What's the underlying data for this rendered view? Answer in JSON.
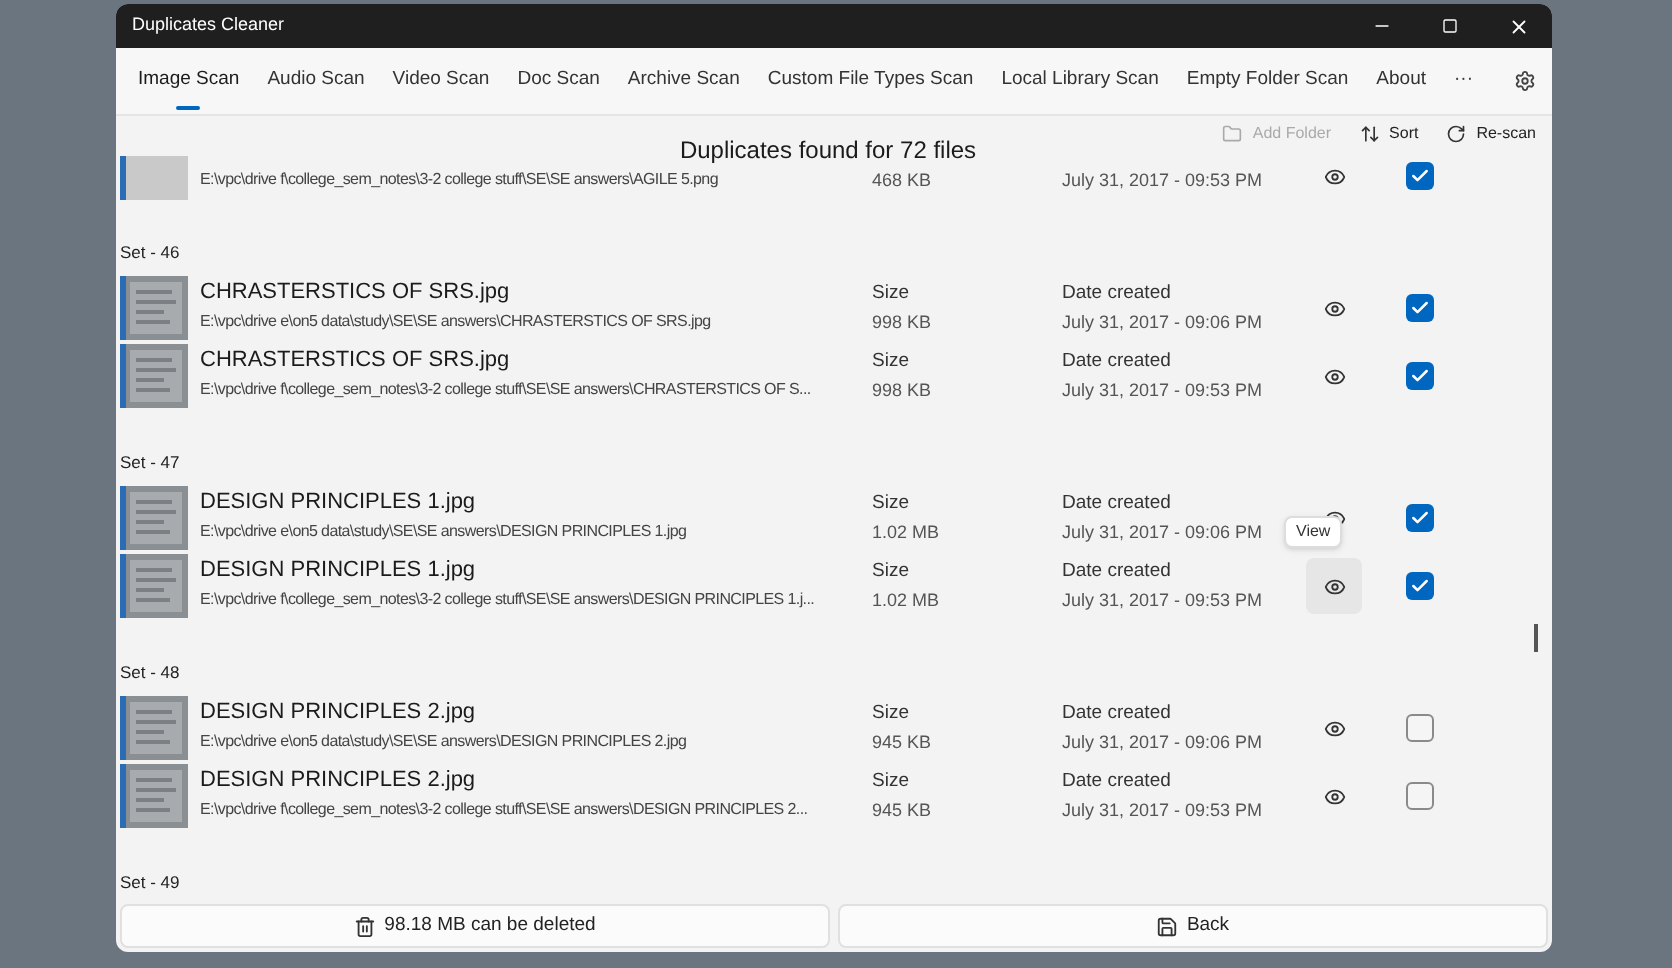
{
  "window": {
    "title": "Duplicates Cleaner"
  },
  "tabs": [
    {
      "label": "Image Scan",
      "selected": true
    },
    {
      "label": "Audio Scan",
      "selected": false
    },
    {
      "label": "Video Scan",
      "selected": false
    },
    {
      "label": "Doc Scan",
      "selected": false
    },
    {
      "label": "Archive Scan",
      "selected": false
    },
    {
      "label": "Custom File Types Scan",
      "selected": false
    },
    {
      "label": "Local Library Scan",
      "selected": false
    },
    {
      "label": "Empty Folder Scan",
      "selected": false
    },
    {
      "label": "About",
      "selected": false
    },
    {
      "label": "···",
      "selected": false
    }
  ],
  "heading": "Duplicates found for 72 files",
  "toolbar": [
    {
      "label": "Add Folder",
      "kind": "folder",
      "disabled": true
    },
    {
      "label": "Sort",
      "kind": "sort",
      "disabled": false
    },
    {
      "label": "Re-scan",
      "kind": "rescan",
      "disabled": false
    }
  ],
  "sets": [
    {
      "rows": [
        {
          "path": "E:\\vpc\\drive f\\college_sem_notes\\3-2 college stuff\\SE\\SE answers\\AGILE 5.png",
          "size": "468 KB",
          "date": "July 31, 2017 - 09:53 PM",
          "checked": true
        }
      ]
    },
    {
      "label": "Set - 46",
      "rows": [
        {
          "name": "CHRASTERSTICS OF SRS.jpg",
          "path": "E:\\vpc\\drive e\\on5 data\\study\\SE\\SE answers\\CHRASTERSTICS OF SRS.jpg",
          "size_label": "Size",
          "size": "998 KB",
          "date_label": "Date created",
          "date": "July 31, 2017 - 09:06 PM",
          "checked": true
        },
        {
          "name": "CHRASTERSTICS OF SRS.jpg",
          "path": "E:\\vpc\\drive f\\college_sem_notes\\3-2 college stuff\\SE\\SE answers\\CHRASTERSTICS OF S...",
          "size_label": "Size",
          "size": "998 KB",
          "date_label": "Date created",
          "date": "July 31, 2017 - 09:53 PM",
          "checked": true
        }
      ]
    },
    {
      "label": "Set - 47",
      "rows": [
        {
          "name": "DESIGN PRINCIPLES 1.jpg",
          "path": "E:\\vpc\\drive e\\on5 data\\study\\SE\\SE answers\\DESIGN PRINCIPLES 1.jpg",
          "size_label": "Size",
          "size": "1.02 MB",
          "date_label": "Date created",
          "date": "July 31, 2017 - 09:06 PM",
          "checked": true
        },
        {
          "name": "DESIGN PRINCIPLES 1.jpg",
          "path": "E:\\vpc\\drive f\\college_sem_notes\\3-2 college stuff\\SE\\SE answers\\DESIGN PRINCIPLES 1.j...",
          "size_label": "Size",
          "size": "1.02 MB",
          "date_label": "Date created",
          "date": "July 31, 2017 - 09:53 PM",
          "checked": true,
          "tooltip": "View"
        }
      ]
    },
    {
      "label": "Set - 48",
      "rows": [
        {
          "name": "DESIGN PRINCIPLES 2.jpg",
          "path": "E:\\vpc\\drive e\\on5 data\\study\\SE\\SE answers\\DESIGN PRINCIPLES 2.jpg",
          "size_label": "Size",
          "size": "945 KB",
          "date_label": "Date created",
          "date": "July 31, 2017 - 09:06 PM",
          "checked": false
        },
        {
          "name": "DESIGN PRINCIPLES 2.jpg",
          "path": "E:\\vpc\\drive f\\college_sem_notes\\3-2 college stuff\\SE\\SE answers\\DESIGN PRINCIPLES 2...",
          "size_label": "Size",
          "size": "945 KB",
          "date_label": "Date created",
          "date": "July 31, 2017 - 09:53 PM",
          "checked": false
        }
      ]
    },
    {
      "label": "Set - 49"
    }
  ],
  "footer": {
    "delete_label": "98.18 MB can be deleted",
    "backup_label": "Back"
  }
}
